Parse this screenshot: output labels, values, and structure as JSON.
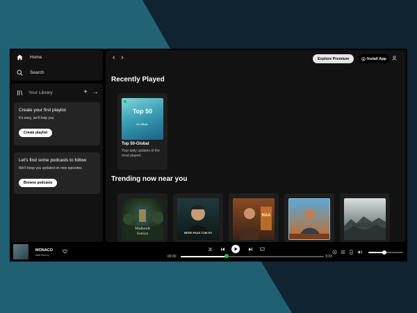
{
  "sidebar": {
    "home_label": "Home",
    "search_label": "Search",
    "library_label": "Your Library",
    "playlist_promo": {
      "title": "Create your first playlist",
      "subtitle": "It's easy, we'll help you",
      "button": "Create playlist"
    },
    "podcast_promo": {
      "title": "Let's find some podcasts to follow",
      "subtitle": "We'll keep you updated on new episodes",
      "button": "Browse podcasts"
    }
  },
  "topbar": {
    "explore_label": "Explore Premium",
    "install_label": "Install App"
  },
  "recently_played": {
    "title": "Recently Played",
    "items": [
      {
        "cover_title": "Top 50",
        "cover_subtitle": "GLOBAL",
        "name": "Top 50-Global",
        "description": "Your daily updates of the most played..."
      }
    ]
  },
  "trending": {
    "title": "Trending now near you",
    "items": [
      {
        "cover_text_1": "Mahesh",
        "cover_text_2": "Soniya"
      },
      {
        "cover_text_1": "MERE PAAS TUM HO"
      },
      {
        "cover_text_1": "NAA"
      },
      {
        "cover_text_1": ""
      },
      {
        "cover_text_1": "PARADISE"
      }
    ]
  },
  "player": {
    "track_title": "MONACO",
    "track_artist": "Bad Bunny",
    "current_time": "00:00",
    "total_time": "3:33",
    "progress": 0.32,
    "volume": 0.45
  },
  "colors": {
    "accent": "#1db954",
    "background": "#000000",
    "panel": "#121212"
  }
}
